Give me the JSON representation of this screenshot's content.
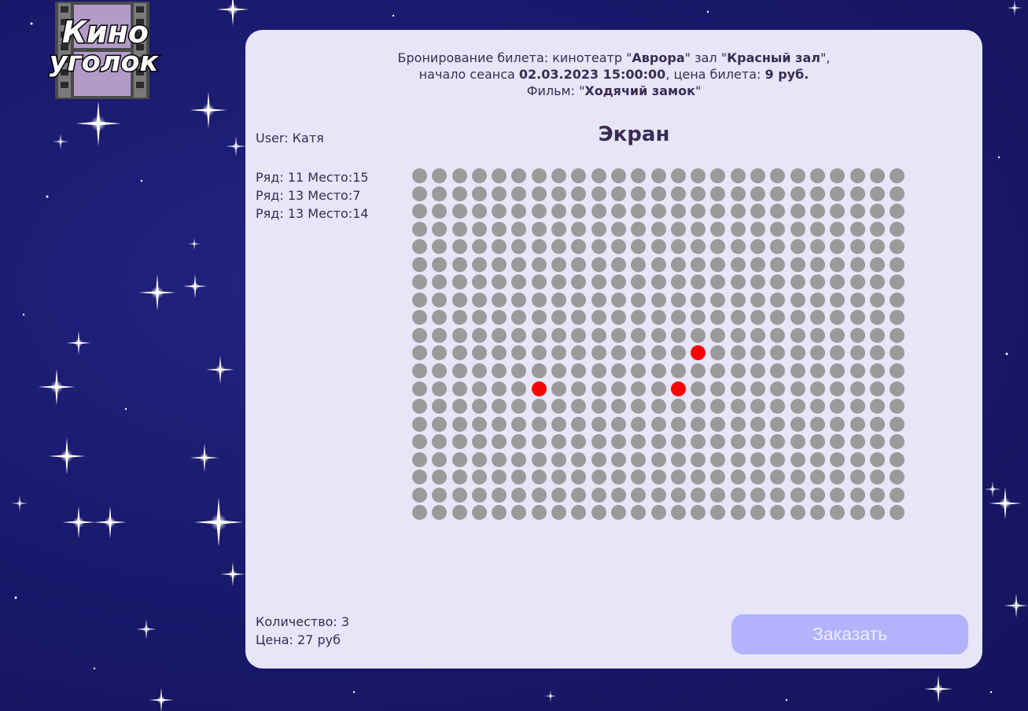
{
  "logo": {
    "line1": "Кино",
    "line2": "уголок"
  },
  "booking": {
    "line1_prefix": "Бронирование билета: кинотеатр \"",
    "cinema": "Аврора",
    "line1_mid": "\" зал \"",
    "hall": "Красный зал",
    "line1_suffix": "\",",
    "line2_prefix": "начало сеанса ",
    "datetime": "02.03.2023 15:00:00",
    "line2_mid": ", цена билета: ",
    "price": "9 руб.",
    "line3_prefix": "Фильм: \"",
    "film": "Ходячий замок",
    "line3_suffix": "\""
  },
  "user_label": "User: Катя",
  "screen_label": "Экран",
  "selected_seats": [
    "Ряд: 11 Место:15",
    "Ряд: 13 Место:7",
    "Ряд: 13 Место:14"
  ],
  "hall_layout": {
    "rows": 20,
    "seats_per_row": 25
  },
  "taken_seats": [
    {
      "row": 11,
      "seat": 15
    },
    {
      "row": 13,
      "seat": 7
    },
    {
      "row": 13,
      "seat": 14
    }
  ],
  "summary": {
    "quantity": "Количество: 3",
    "total": "Цена: 27 руб"
  },
  "order_button": "Заказать",
  "colors": {
    "seat_free": "#9a9a9a",
    "seat_selected": "#ff0000",
    "panel": "#e6e6f8",
    "button": "#b3b3fb"
  }
}
